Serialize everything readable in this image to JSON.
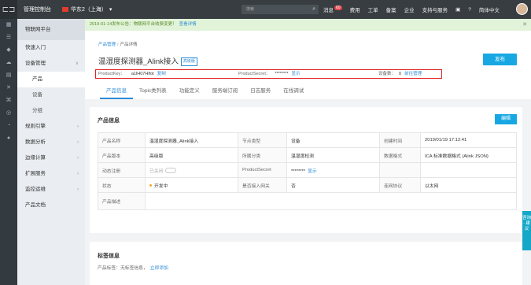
{
  "topbar": {
    "console": "管理控制台",
    "region": "华东2（上海）",
    "search_placeholder": "搜索",
    "nav": [
      "消息",
      "费用",
      "工单",
      "备案",
      "企业",
      "支持与服务"
    ],
    "message_count": "60",
    "language": "简体中文"
  },
  "sidebar": {
    "title": "物联网平台",
    "items": [
      {
        "label": "快速入门"
      },
      {
        "label": "设备管理"
      },
      {
        "label": "产品"
      },
      {
        "label": "设备"
      },
      {
        "label": "分组"
      },
      {
        "label": "规则引擎"
      },
      {
        "label": "数据分析"
      },
      {
        "label": "边缘计算"
      },
      {
        "label": "扩展服务"
      },
      {
        "label": "监控运维"
      },
      {
        "label": "产品文档"
      }
    ]
  },
  "notice": {
    "text": "2019-01-14发布公告：物联网平台收费变更！",
    "link": "查看详情"
  },
  "header": {
    "breadcrumb_parent": "产品管理",
    "breadcrumb_current": "产品详情",
    "title": "温湿度探测器_Alink接入",
    "tag": "高级版",
    "publish": "发布",
    "product_key_label": "ProductKey：",
    "product_key_value": "a1lH07Hifot",
    "copy": "复制",
    "product_secret_label": "ProductSecret：",
    "product_secret_value": "********",
    "show": "显示",
    "device_count_label": "设备数：",
    "device_count_value": "0",
    "go_manage": "前往管理"
  },
  "tabs": [
    "产品信息",
    "Topic类列表",
    "功能定义",
    "服务端订阅",
    "日志服务",
    "在线调试"
  ],
  "product_info": {
    "title": "产品信息",
    "edit": "编辑",
    "labels": {
      "name": "产品名称",
      "node_type": "节点类型",
      "created": "创建时间",
      "version": "产品版本",
      "category": "所属分类",
      "data_format": "数据格式",
      "dynamic_reg": "动态注册",
      "secret": "ProductSecret",
      "status": "状态",
      "gateway": "是否接入网关",
      "protocol": "连网协议",
      "desc": "产品描述"
    },
    "values": {
      "name": "温湿度探测器_Alink接入",
      "node_type": "设备",
      "created": "2019/01/19 17:12:41",
      "version": "高级版",
      "category": "温湿度检测",
      "data_format": "ICA 标准数据格式 (Alink JSON)",
      "dynamic_reg": "已关闭",
      "secret": "********",
      "secret_show": "显示",
      "status": "开发中",
      "gateway": "否",
      "protocol": "以太网",
      "desc": ""
    }
  },
  "tags_info": {
    "title": "标签信息",
    "label": "产品标签：无标签信息，",
    "add": "立即添加"
  },
  "float_button": "咨询 · 建议"
}
